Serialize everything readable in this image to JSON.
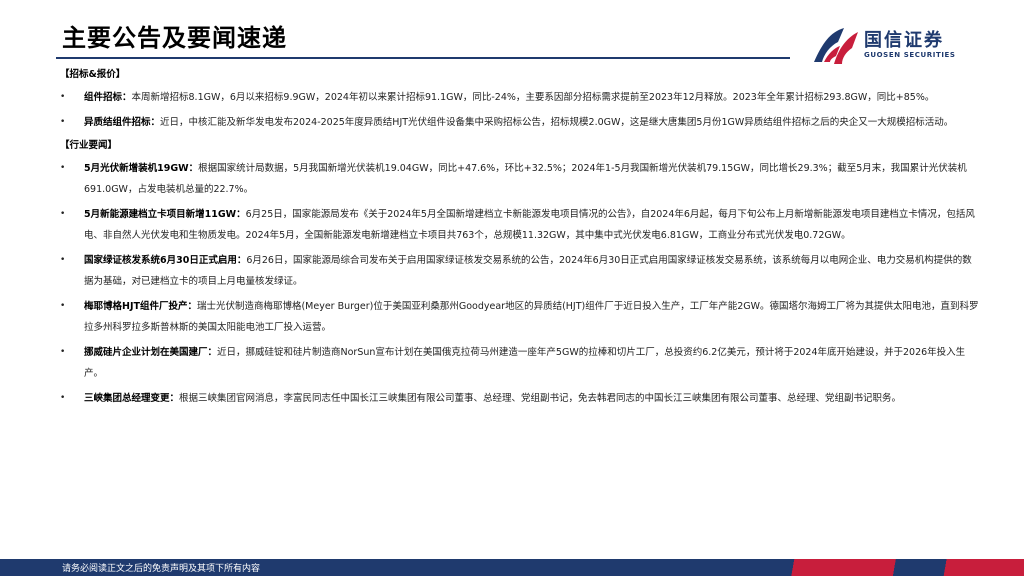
{
  "header": {
    "title": "主要公告及要闻速递",
    "logo_cn": "国信证券",
    "logo_en": "GUOSEN SECURITIES",
    "colors": {
      "primary": "#1f3a6e",
      "accent": "#c81e3c"
    }
  },
  "sections": [
    {
      "heading": "【招标&报价】",
      "items": [
        {
          "lead": "组件招标：",
          "text": "本周新增招标8.1GW，6月以来招标9.9GW，2024年初以来累计招标91.1GW，同比-24%，主要系因部分招标需求提前至2023年12月释放。2023年全年累计招标293.8GW，同比+85%。"
        },
        {
          "lead": "异质结组件招标：",
          "text": "近日，中核汇能及新华发电发布2024-2025年度异质结HJT光伏组件设备集中采购招标公告，招标规模2.0GW，这是继大唐集团5月份1GW异质结组件招标之后的央企又一大规模招标活动。"
        }
      ]
    },
    {
      "heading": "【行业要闻】",
      "items": [
        {
          "lead": "5月光伏新增装机19GW：",
          "text": "根据国家统计局数据，5月我国新增光伏装机19.04GW，同比+47.6%，环比+32.5%；2024年1-5月我国新增光伏装机79.15GW，同比增长29.3%；截至5月末，我国累计光伏装机691.0GW，占发电装机总量的22.7%。"
        },
        {
          "lead": "5月新能源建档立卡项目新增11GW：",
          "text": "6月25日，国家能源局发布《关于2024年5月全国新增建档立卡新能源发电项目情况的公告》，自2024年6月起，每月下旬公布上月新增新能源发电项目建档立卡情况，包括风电、非自然人光伏发电和生物质发电。2024年5月，全国新能源发电新增建档立卡项目共763个，总规模11.32GW，其中集中式光伏发电6.81GW，工商业分布式光伏发电0.72GW。"
        },
        {
          "lead": "国家绿证核发系统6月30日正式启用：",
          "text": "6月26日，国家能源局综合司发布关于启用国家绿证核发交易系统的公告，2024年6月30日正式启用国家绿证核发交易系统，该系统每月以电网企业、电力交易机构提供的数据为基础，对已建档立卡的项目上月电量核发绿证。"
        },
        {
          "lead": "梅耶博格HJT组件厂投产：",
          "text": "瑞士光伏制造商梅耶博格(Meyer Burger)位于美国亚利桑那州Goodyear地区的异质结(HJT)组件厂于近日投入生产，工厂年产能2GW。德国塔尔海姆工厂将为其提供太阳电池，直到科罗拉多州科罗拉多斯普林斯的美国太阳能电池工厂投入运营。"
        },
        {
          "lead": "挪威硅片企业计划在美国建厂：",
          "text": "近日，挪威硅锭和硅片制造商NorSun宣布计划在美国俄克拉荷马州建造一座年产5GW的拉棒和切片工厂，总投资约6.2亿美元，预计将于2024年底开始建设，并于2026年投入生产。"
        },
        {
          "lead": "三峡集团总经理变更：",
          "text": "根据三峡集团官网消息，李富民同志任中国长江三峡集团有限公司董事、总经理、党组副书记，免去韩君同志的中国长江三峡集团有限公司董事、总经理、党组副书记职务。"
        }
      ]
    }
  ],
  "footer": {
    "disclaimer": "请务必阅读正文之后的免责声明及其项下所有内容"
  }
}
